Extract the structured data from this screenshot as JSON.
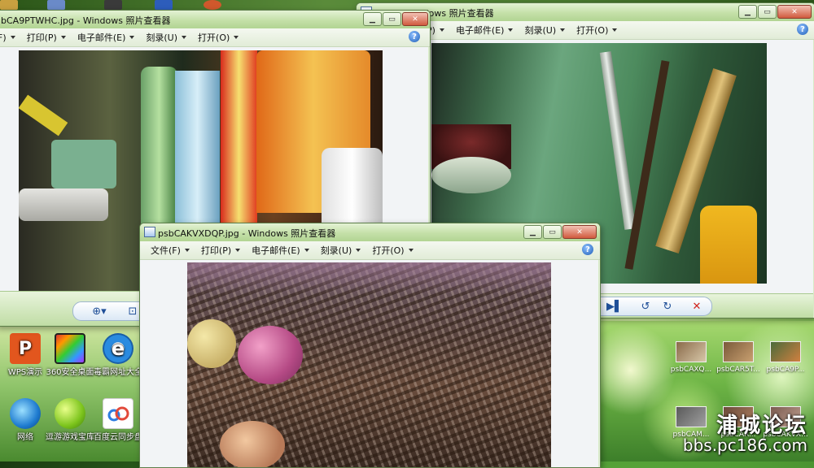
{
  "windows": {
    "w1": {
      "title": "bCA9PTWHC.jpg - Windows 照片查看器",
      "menus": [
        {
          "label": "F)"
        },
        {
          "label": "打印(P)"
        },
        {
          "label": "电子邮件(E)"
        },
        {
          "label": "刻录(U)"
        },
        {
          "label": "打开(O)"
        }
      ],
      "help_glyph": "?"
    },
    "w2": {
      "title": "…jpg - Windows 照片查看器",
      "menus": [
        {
          "label": "P)"
        },
        {
          "label": "电子邮件(E)"
        },
        {
          "label": "刻录(U)"
        },
        {
          "label": "打开(O)"
        }
      ],
      "help_glyph": "?"
    },
    "w3": {
      "title": "psbCAKVXDQP.jpg - Windows 照片查看器",
      "menus": [
        {
          "label": "文件(F)"
        },
        {
          "label": "打印(P)"
        },
        {
          "label": "电子邮件(E)"
        },
        {
          "label": "刻录(U)"
        },
        {
          "label": "打开(O)"
        }
      ],
      "help_glyph": "?"
    }
  },
  "caption_buttons": {
    "minimize": "▁",
    "maximize": "▭",
    "close": "✕"
  },
  "toolbar": {
    "zoom_glyph": "⊕▾",
    "fit_glyph": "⊡",
    "play_glyph": "▶▌",
    "rotate_ccw_glyph": "↺",
    "rotate_cw_glyph": "↻",
    "delete_glyph": "✕"
  },
  "desktop_icons": [
    {
      "label": "WPS演示",
      "icon": "wps-presentation-icon"
    },
    {
      "label": "360安全桌面",
      "icon": "360-desktop-icon"
    },
    {
      "label": "毒霸网址大全",
      "icon": "internet-explorer-icon"
    },
    {
      "label": "网络",
      "icon": "network-icon"
    },
    {
      "label": "逗游游戏宝库",
      "icon": "game-icon"
    },
    {
      "label": "百度云同步盘",
      "icon": "baidu-cloud-icon"
    }
  ],
  "thumbnails": [
    {
      "label": "psbCAXQ..."
    },
    {
      "label": "psbCAR5T..."
    },
    {
      "label": "psbCA9P..."
    },
    {
      "label": "psbCAM..."
    },
    {
      "label": "psbCAR..."
    },
    {
      "label": "psbCAKVX..."
    }
  ],
  "watermark": {
    "line1": "浦城论坛",
    "line2": "bbs.pc186.com"
  },
  "colors": {
    "window_frame": "#c4e0a8",
    "close_button": "#d15a3e",
    "accent_blue": "#1f5fb8"
  }
}
